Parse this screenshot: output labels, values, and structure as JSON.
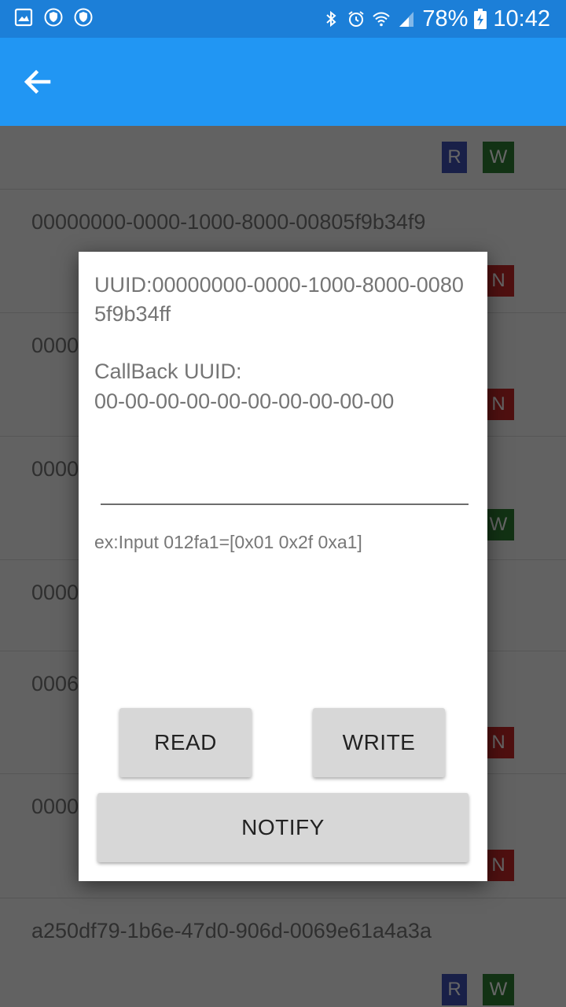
{
  "status_bar": {
    "left_icons": [
      "gallery-icon",
      "shield-icon",
      "shield-icon"
    ],
    "right_icons": [
      "bluetooth-icon",
      "alarm-icon",
      "wifi-icon",
      "signal-icon"
    ],
    "battery": "78%",
    "time": "10:42",
    "colors": {
      "background": "#1c7fd8"
    }
  },
  "app_bar": {
    "back_icon": "arrow-left-icon",
    "colors": {
      "background": "#2196f3"
    }
  },
  "list": {
    "rows": [
      {
        "title": "",
        "badges": [
          "R",
          "W"
        ]
      },
      {
        "title": "00000000-0000-1000-8000-00805f9b34f9",
        "badges": [
          "N"
        ]
      },
      {
        "title": "0000",
        "badges": [
          "N"
        ]
      },
      {
        "title": "0000",
        "badges": [
          "W"
        ]
      },
      {
        "title": "0000",
        "badges": []
      },
      {
        "title": "0006",
        "badges": [
          "N"
        ]
      },
      {
        "title": "0000",
        "badges": [
          "N"
        ]
      },
      {
        "title": "a250df79-1b6e-47d0-906d-0069e61a4a3a",
        "badges": [
          "R",
          "W"
        ]
      }
    ],
    "badge_colors": {
      "R": "#3f51b5",
      "W": "#2e7d32",
      "N": "#c62828"
    }
  },
  "dialog": {
    "uuid": "UUID:00000000-0000-1000-8000-00805f9b34ff",
    "callback_label": "CallBack UUID:",
    "callback_value": "00-00-00-00-00-00-00-00-00-00",
    "input_value": "",
    "hint": "ex:Input 012fa1=[0x01 0x2f 0xa1]",
    "buttons": {
      "read": "READ",
      "write": "WRITE",
      "notify": "NOTIFY"
    }
  }
}
